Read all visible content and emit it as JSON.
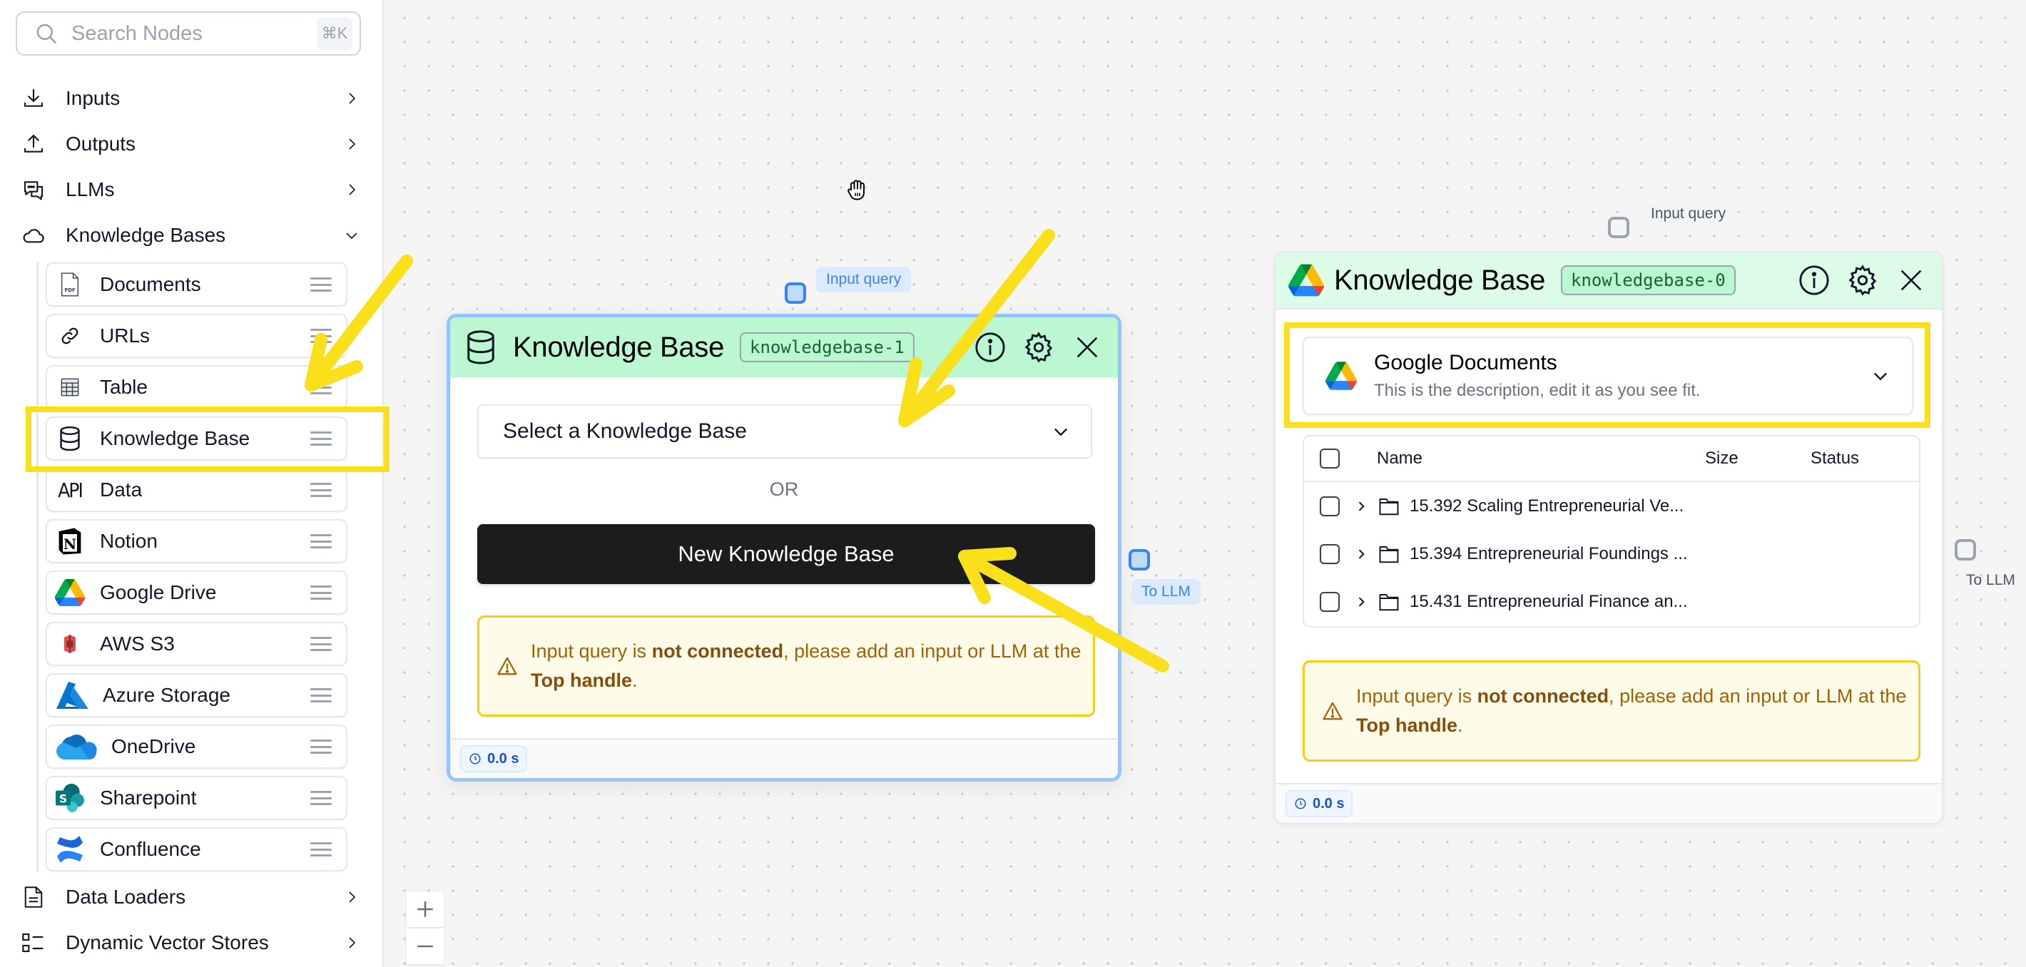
{
  "sidebar": {
    "search": {
      "placeholder": "Search Nodes",
      "shortcut": "⌘K",
      "icon": "search-icon"
    },
    "categories": [
      {
        "label": "Inputs",
        "icon": "download-icon",
        "expanded": false
      },
      {
        "label": "Outputs",
        "icon": "upload-icon",
        "expanded": false
      },
      {
        "label": "LLMs",
        "icon": "chat-bubbles-icon",
        "expanded": false
      },
      {
        "label": "Knowledge Bases",
        "icon": "cloud-icon",
        "expanded": true
      }
    ],
    "kb_items": [
      {
        "label": "Documents",
        "icon": "pdf-file-icon"
      },
      {
        "label": "URLs",
        "icon": "link-icon"
      },
      {
        "label": "Table",
        "icon": "table-icon"
      },
      {
        "label": "Knowledge Base",
        "icon": "database-icon",
        "highlighted": true
      },
      {
        "label": "Data",
        "icon": "api-icon"
      },
      {
        "label": "Notion",
        "icon": "notion-icon"
      },
      {
        "label": "Google Drive",
        "icon": "google-drive-icon"
      },
      {
        "label": "AWS S3",
        "icon": "aws-s3-icon"
      },
      {
        "label": "Azure Storage",
        "icon": "azure-icon"
      },
      {
        "label": "OneDrive",
        "icon": "onedrive-icon"
      },
      {
        "label": "Sharepoint",
        "icon": "sharepoint-icon"
      },
      {
        "label": "Confluence",
        "icon": "confluence-icon"
      }
    ],
    "bottom_categories": [
      {
        "label": "Data Loaders",
        "icon": "document-icon"
      },
      {
        "label": "Dynamic Vector Stores",
        "icon": "list-icon"
      }
    ]
  },
  "canvas": {
    "zoom_in": "+",
    "zoom_out": "−",
    "cursor": "hand-grab-icon"
  },
  "node_new": {
    "title": "Knowledge Base",
    "id_badge": "knowledgebase-1",
    "input_handle_label": "Input query",
    "output_handle_label": "To LLM",
    "select_placeholder": "Select a Knowledge Base",
    "or_text": "OR",
    "new_button": "New Knowledge Base",
    "warning": {
      "pre": "Input query is ",
      "bold1": "not connected",
      "mid": ", please add an input or LLM at the ",
      "bold2": "Top handle",
      "post": "."
    },
    "timer": "0.0 s"
  },
  "node_existing": {
    "title": "Knowledge Base",
    "id_badge": "knowledgebase-0",
    "input_handle_label": "Input query",
    "output_handle_label": "To LLM",
    "selected_kb": {
      "name": "Google Documents",
      "description": "This is the description, edit it as you see fit."
    },
    "table": {
      "columns": [
        "Name",
        "Size",
        "Status"
      ],
      "rows": [
        {
          "name": "15.392 Scaling Entrepreneurial Ve...",
          "size": "",
          "status": ""
        },
        {
          "name": "15.394 Entrepreneurial Foundings ...",
          "size": "",
          "status": ""
        },
        {
          "name": "15.431 Entrepreneurial Finance an...",
          "size": "",
          "status": ""
        }
      ]
    },
    "warning": {
      "pre": "Input query is ",
      "bold1": "not connected",
      "mid": ", please add an input or LLM at the ",
      "bold2": "Top handle",
      "post": "."
    },
    "timer": "0.0 s"
  },
  "colors": {
    "annotation_yellow": "#fadf1b",
    "node_header_active": "#bbf7d0",
    "node_border_selected": "#93c5fd",
    "warning_border": "#facc15",
    "warning_text": "#a16207"
  }
}
